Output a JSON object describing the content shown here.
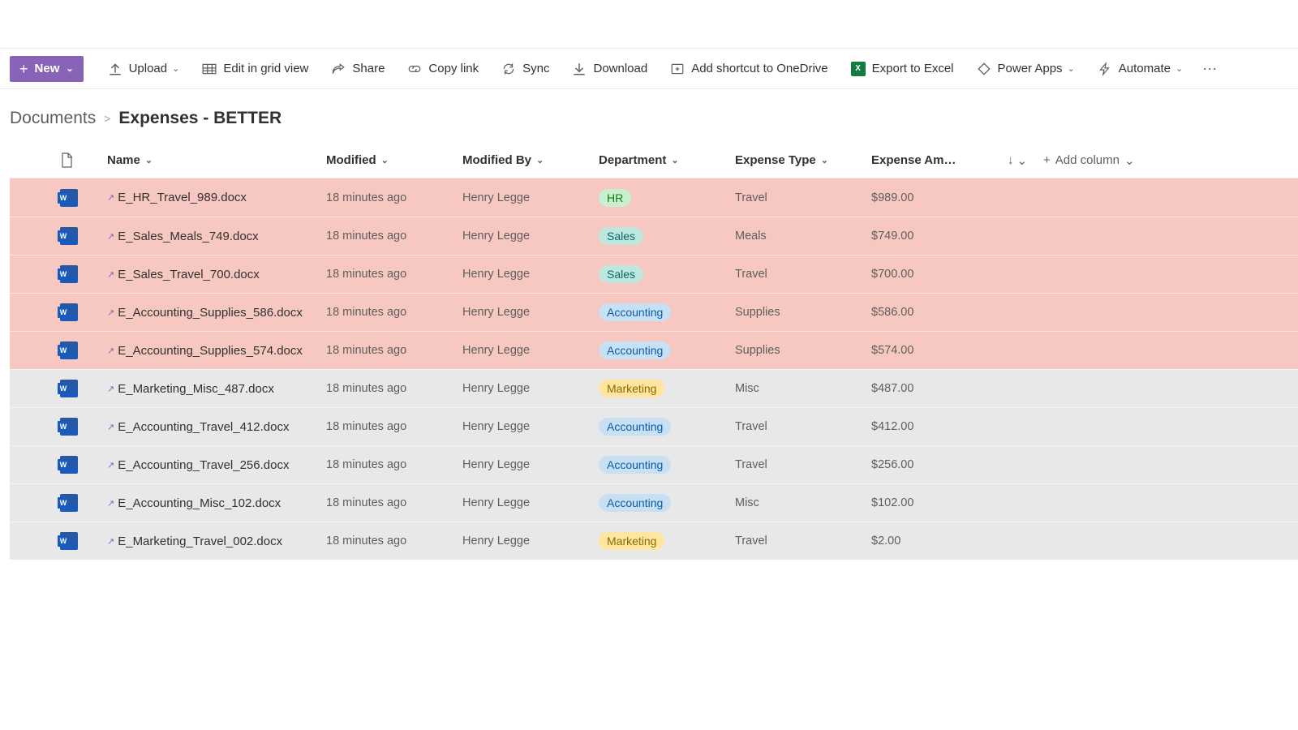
{
  "toolbar": {
    "new_label": "New",
    "upload_label": "Upload",
    "grid_label": "Edit in grid view",
    "share_label": "Share",
    "copylink_label": "Copy link",
    "sync_label": "Sync",
    "download_label": "Download",
    "shortcut_label": "Add shortcut to OneDrive",
    "export_label": "Export to Excel",
    "powerapps_label": "Power Apps",
    "automate_label": "Automate"
  },
  "breadcrumb": {
    "parent": "Documents",
    "current": "Expenses - BETTER"
  },
  "columns": {
    "name": "Name",
    "modified": "Modified",
    "modified_by": "Modified By",
    "department": "Department",
    "expense_type": "Expense Type",
    "expense_amount": "Expense Am…",
    "add_column": "Add column"
  },
  "rows": [
    {
      "name": "E_HR_Travel_989.docx",
      "modified": "18 minutes ago",
      "by": "Henry Legge",
      "dept": "HR",
      "dept_class": "pill-hr",
      "etype": "Travel",
      "amount": "$989.00",
      "hl": true
    },
    {
      "name": "E_Sales_Meals_749.docx",
      "modified": "18 minutes ago",
      "by": "Henry Legge",
      "dept": "Sales",
      "dept_class": "pill-sales",
      "etype": "Meals",
      "amount": "$749.00",
      "hl": true
    },
    {
      "name": "E_Sales_Travel_700.docx",
      "modified": "18 minutes ago",
      "by": "Henry Legge",
      "dept": "Sales",
      "dept_class": "pill-sales",
      "etype": "Travel",
      "amount": "$700.00",
      "hl": true
    },
    {
      "name": "E_Accounting_Supplies_586.docx",
      "modified": "18 minutes ago",
      "by": "Henry Legge",
      "dept": "Accounting",
      "dept_class": "pill-acct",
      "etype": "Supplies",
      "amount": "$586.00",
      "hl": true
    },
    {
      "name": "E_Accounting_Supplies_574.docx",
      "modified": "18 minutes ago",
      "by": "Henry Legge",
      "dept": "Accounting",
      "dept_class": "pill-acct",
      "etype": "Supplies",
      "amount": "$574.00",
      "hl": true
    },
    {
      "name": "E_Marketing_Misc_487.docx",
      "modified": "18 minutes ago",
      "by": "Henry Legge",
      "dept": "Marketing",
      "dept_class": "pill-mkt",
      "etype": "Misc",
      "amount": "$487.00",
      "hl": false
    },
    {
      "name": "E_Accounting_Travel_412.docx",
      "modified": "18 minutes ago",
      "by": "Henry Legge",
      "dept": "Accounting",
      "dept_class": "pill-acct",
      "etype": "Travel",
      "amount": "$412.00",
      "hl": false
    },
    {
      "name": "E_Accounting_Travel_256.docx",
      "modified": "18 minutes ago",
      "by": "Henry Legge",
      "dept": "Accounting",
      "dept_class": "pill-acct",
      "etype": "Travel",
      "amount": "$256.00",
      "hl": false
    },
    {
      "name": "E_Accounting_Misc_102.docx",
      "modified": "18 minutes ago",
      "by": "Henry Legge",
      "dept": "Accounting",
      "dept_class": "pill-acct",
      "etype": "Misc",
      "amount": "$102.00",
      "hl": false
    },
    {
      "name": "E_Marketing_Travel_002.docx",
      "modified": "18 minutes ago",
      "by": "Henry Legge",
      "dept": "Marketing",
      "dept_class": "pill-mkt",
      "etype": "Travel",
      "amount": "$2.00",
      "hl": false
    }
  ]
}
